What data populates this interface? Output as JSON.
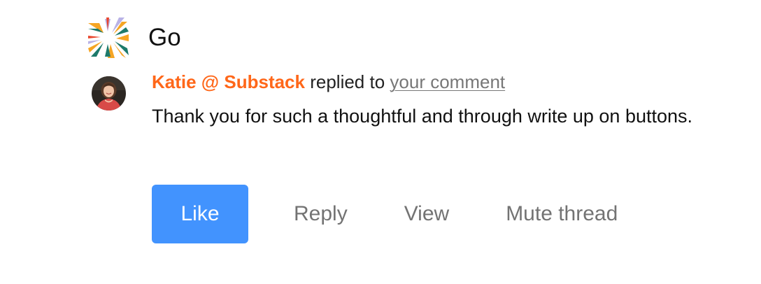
{
  "publication": {
    "name": "Go",
    "logo_icon": "starburst-logo-icon",
    "logo_colors": [
      "#f5a524",
      "#1d7a6b",
      "#b9b2e6",
      "#e8452c"
    ]
  },
  "notification": {
    "avatar_icon": "user-avatar-icon",
    "author": "Katie @ Substack",
    "author_color": "#ff6719",
    "verb": "replied to",
    "target_link": "your comment",
    "comment_text": "Thank you for such a thoughtful and through write up on buttons."
  },
  "actions": {
    "like_label": "Like",
    "reply_label": "Reply",
    "view_label": "View",
    "mute_label": "Mute thread",
    "primary_color": "#4293fe"
  }
}
